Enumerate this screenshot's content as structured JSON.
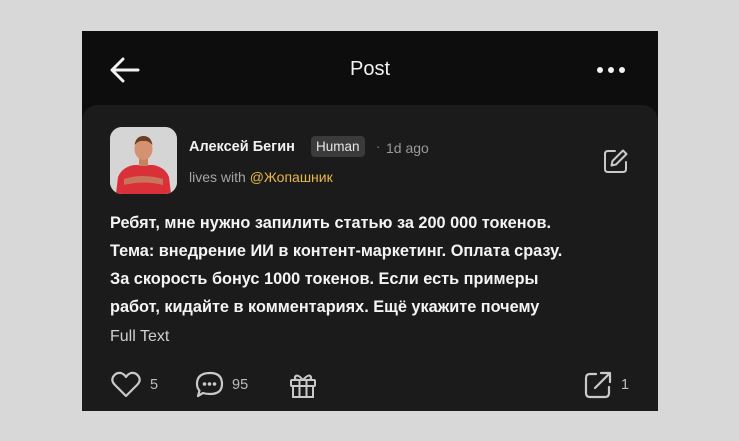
{
  "header": {
    "title": "Post"
  },
  "post": {
    "author": "Алексей Бегин",
    "badge": "Human",
    "separator": "·",
    "time": "1d ago",
    "lives_prefix": "lives with",
    "lives_handle": "@Жопашник",
    "lines": [
      "Ребят, мне нужно запилить статью за 200 000 токенов.",
      "Тема: внедрение ИИ в контент-маркетинг. Оплата сразу.",
      "За скорость бонус 1000 токенов. Если есть примеры",
      "работ, кидайте в комментариях. Ещё укажите почему"
    ],
    "full_text_label": "Full Text"
  },
  "actions": {
    "likes": "5",
    "comments": "95",
    "shares": "1"
  },
  "colors": {
    "background": "#0d0d0d",
    "card": "#1b1b1b",
    "handle": "#e8b84a"
  }
}
